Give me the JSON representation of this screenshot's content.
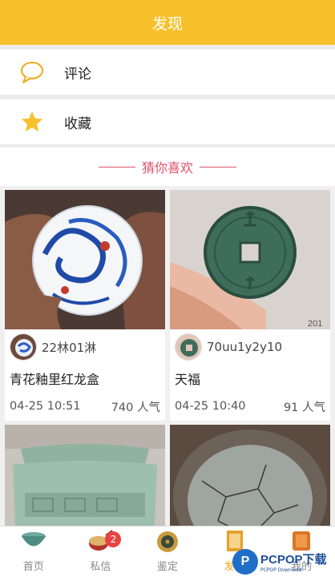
{
  "header": {
    "title": "发现"
  },
  "menu": [
    {
      "label": "评论",
      "icon": "comment-icon"
    },
    {
      "label": "收藏",
      "icon": "star-icon"
    }
  ],
  "guess": {
    "title": "猜你喜欢"
  },
  "cards": [
    {
      "user": "22林01淋",
      "name": "青花釉里红龙盒",
      "time": "04-25 10:51",
      "popularity": "740 人气",
      "image": "blue-white-dragon-bowl"
    },
    {
      "user": "70uu1y2y10",
      "name": "天福",
      "time": "04-25 10:40",
      "popularity": "91 人气",
      "image": "ancient-coin"
    },
    {
      "image": "celadon-vase"
    },
    {
      "image": "crackle-glaze-bowl"
    }
  ],
  "tabs": [
    {
      "label": "首页",
      "icon": "bowl-icon",
      "active": false
    },
    {
      "label": "私信",
      "icon": "drum-icon",
      "active": false,
      "badge": "2"
    },
    {
      "label": "鉴定",
      "icon": "compass-icon",
      "active": false
    },
    {
      "label": "发现",
      "icon": "lantern-icon",
      "active": true
    },
    {
      "label": "我的",
      "icon": "seal-icon",
      "active": false
    }
  ],
  "watermark": {
    "text": "PCPOP下载",
    "small": "PCPOP Download"
  },
  "colors": {
    "accent": "#f8c12c",
    "pink": "#e0506a",
    "badge": "#e94343"
  }
}
